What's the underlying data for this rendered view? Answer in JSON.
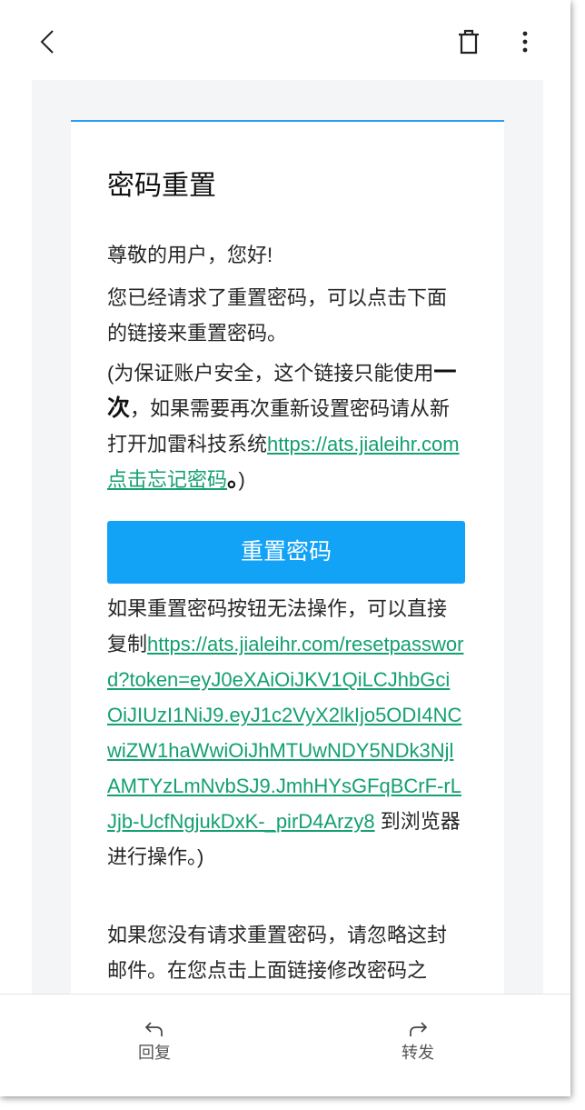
{
  "toolbar": {
    "back_icon": "chevron-left-icon",
    "delete_icon": "trash-icon",
    "more_icon": "more-vertical-icon"
  },
  "email": {
    "title": "密码重置",
    "greeting": "尊敬的用户，您好!",
    "intro": "您已经请求了重置密码，可以点击下面的链接来重置密码。",
    "notice": {
      "before": "(为保证账户安全，这个链接只能使用",
      "emphasis": "一次",
      "middle": "，如果需要再次重新设置密码请从新打开加雷科技系统",
      "link": "https://ats.jialeihr.com点击忘记密码",
      "end_emphasis": "。",
      "after": ")"
    },
    "reset_button": "重置密码",
    "fallback": {
      "before": "如果重置密码按钮无法操作，可以直接复制",
      "link": "https://ats.jialeihr.com/resetpassword?token=eyJ0eXAiOiJKV1QiLCJhbGciOiJIUzI1NiJ9.eyJ1c2VyX2lkIjo5ODI4NCwiZW1haWwiOiJhMTUwNDY5NDk3NjlAMTYzLmNvbSJ9.JmhHYsGFqBCrF-rLJjb-UcfNgjukDxK-_pirD4Arzy8",
      "after": " 到浏览器进行操作。)"
    },
    "ignore_text": "如果您没有请求重置密码，请忽略这封邮件。在您点击上面链接修改密码之"
  },
  "actions": {
    "reply": {
      "label": "回复",
      "icon": "reply-icon"
    },
    "forward": {
      "label": "转发",
      "icon": "forward-icon"
    }
  },
  "colors": {
    "accent": "#2d9cf0",
    "button": "#12a2f6",
    "link": "#14a06f"
  }
}
